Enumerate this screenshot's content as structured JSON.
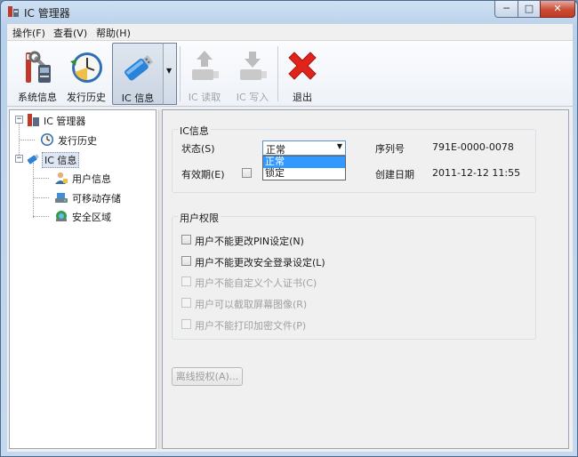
{
  "window": {
    "title": "IC 管理器",
    "controls": {
      "minimize": "─",
      "maximize": "□",
      "close": "✕"
    }
  },
  "menu": [
    {
      "label": "操作(F)"
    },
    {
      "label": "查看(V)"
    },
    {
      "label": "帮助(H)"
    }
  ],
  "toolbar": {
    "buttons": [
      {
        "label": "系统信息",
        "icon": "system-info-icon",
        "state": "normal"
      },
      {
        "label": "发行历史",
        "icon": "history-clock-icon",
        "state": "normal"
      },
      {
        "label": "IC 信息",
        "icon": "usb-key-icon",
        "state": "pressed"
      },
      {
        "label": "IC 读取",
        "icon": "ic-read-icon",
        "state": "disabled"
      },
      {
        "label": "IC 写入",
        "icon": "ic-write-icon",
        "state": "disabled"
      },
      {
        "label": "退出",
        "icon": "exit-x-icon",
        "state": "normal"
      }
    ]
  },
  "tree": {
    "root": "IC 管理器",
    "items": [
      {
        "label": "发行历史"
      },
      {
        "label": "IC 信息",
        "selected": true
      },
      {
        "label": "用户信息"
      },
      {
        "label": "可移动存储"
      },
      {
        "label": "安全区域"
      }
    ]
  },
  "ic_info": {
    "group_title": "IC信息",
    "status_label": "状态(S)",
    "status_value": "正常",
    "status_options": [
      "正常",
      "锁定"
    ],
    "validity_label": "有效期(E)",
    "validity_checked": false,
    "serial_label": "序列号",
    "serial_value": "791E-0000-0078",
    "created_label": "创建日期",
    "created_value": "2011-12-12 11:55"
  },
  "permissions": {
    "group_title": "用户权限",
    "items": [
      {
        "label": "用户不能更改PIN设定(N)",
        "enabled": true,
        "checked": false
      },
      {
        "label": "用户不能更改安全登录设定(L)",
        "enabled": true,
        "checked": false
      },
      {
        "label": "用户不能自定义个人证书(C)",
        "enabled": false,
        "checked": false
      },
      {
        "label": "用户可以截取屏幕图像(R)",
        "enabled": false,
        "checked": false
      },
      {
        "label": "用户不能打印加密文件(P)",
        "enabled": false,
        "checked": false
      }
    ]
  },
  "offline_button": {
    "label": "离线授权(A)...",
    "enabled": false
  },
  "colors": {
    "selection": "#3399ff",
    "exit_red": "#e0241b"
  }
}
